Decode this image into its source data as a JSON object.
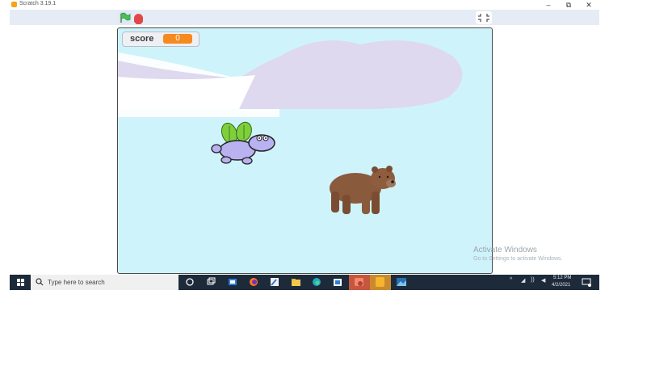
{
  "window": {
    "title": "Scratch 3.19.1",
    "minimize": "–",
    "maximize": "⧉",
    "close": "✕"
  },
  "toolbar": {
    "green_flag": "green-flag",
    "stop": "stop-sign",
    "fullscreen": "fullscreen-exit"
  },
  "stage": {
    "background_color": "#cff3fb",
    "cloud_color": "#ded9ee",
    "monitor": {
      "label": "score",
      "value": "0"
    },
    "sprites": [
      "flying-hippo",
      "brown-bear"
    ]
  },
  "watermark": {
    "line1": "Activate Windows",
    "line2": "Go to Settings to activate Windows."
  },
  "taskbar": {
    "search_placeholder": "Type here to search",
    "pinned_apps": [
      "cortana",
      "task-view",
      "app-blue",
      "firefox",
      "app-paint",
      "file-explorer",
      "edge",
      "app-store",
      "app-red-active",
      "scratch-active",
      "photos"
    ],
    "clock_time": "5:12 PM",
    "clock_date": "4/2/2021"
  }
}
